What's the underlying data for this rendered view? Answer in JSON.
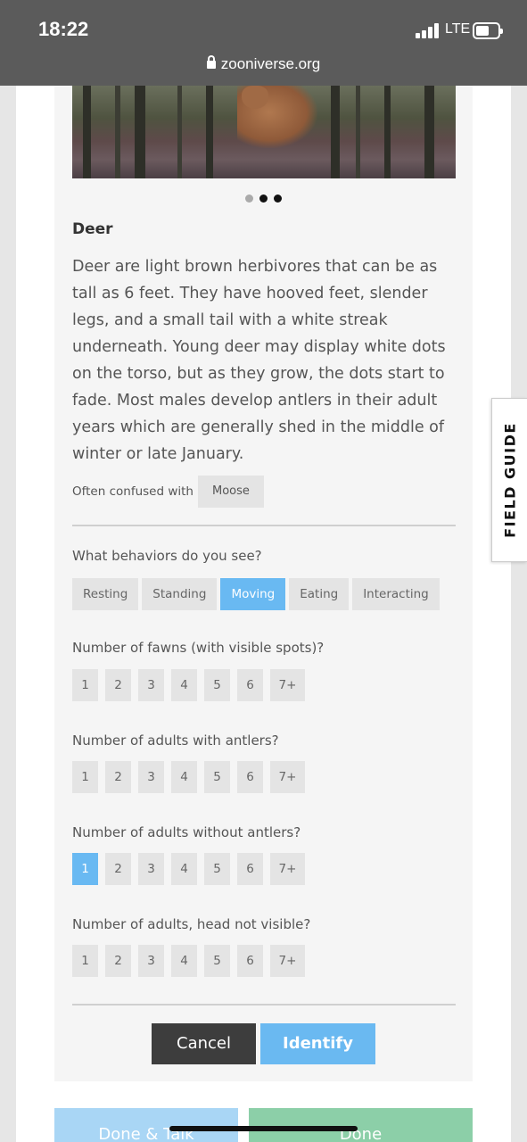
{
  "status_bar": {
    "time": "18:22",
    "network": "LTE",
    "url": "zooniverse.org"
  },
  "carousel": {
    "dot_colors": [
      "#aaaaaa",
      "#111111",
      "#111111"
    ]
  },
  "species": {
    "name": "Deer",
    "description": "Deer are light brown herbivores that can be as tall as 6 feet. They have hooved feet, slender legs, and a small tail with a white streak underneath. Young deer may display white dots on the torso, but as they grow, the dots start to fade. Most males develop antlers in their adult years which are generally shed in the middle of winter or late January.",
    "confused_label": "Often confused with",
    "confused_with": "Moose"
  },
  "behaviors": {
    "question": "What behaviors do you see?",
    "options": [
      "Resting",
      "Standing",
      "Moving",
      "Eating",
      "Interacting"
    ],
    "selected": "Moving"
  },
  "counts": [
    {
      "question": "Number of fawns (with visible spots)?",
      "options": [
        "1",
        "2",
        "3",
        "4",
        "5",
        "6",
        "7+"
      ],
      "selected": null
    },
    {
      "question": "Number of adults with antlers?",
      "options": [
        "1",
        "2",
        "3",
        "4",
        "5",
        "6",
        "7+"
      ],
      "selected": null
    },
    {
      "question": "Number of adults without antlers?",
      "options": [
        "1",
        "2",
        "3",
        "4",
        "5",
        "6",
        "7+"
      ],
      "selected": "1"
    },
    {
      "question": "Number of adults, head not visible?",
      "options": [
        "1",
        "2",
        "3",
        "4",
        "5",
        "6",
        "7+"
      ],
      "selected": null
    }
  ],
  "actions": {
    "cancel": "Cancel",
    "identify": "Identify"
  },
  "footer": {
    "done_talk": "Done & Talk",
    "done": "Done"
  },
  "side_tab": {
    "label": "FIELD GUIDE"
  },
  "colors": {
    "accent": "#69b9f2",
    "dark_button": "#3d3d3d",
    "done_green": "#8ccfa8"
  }
}
